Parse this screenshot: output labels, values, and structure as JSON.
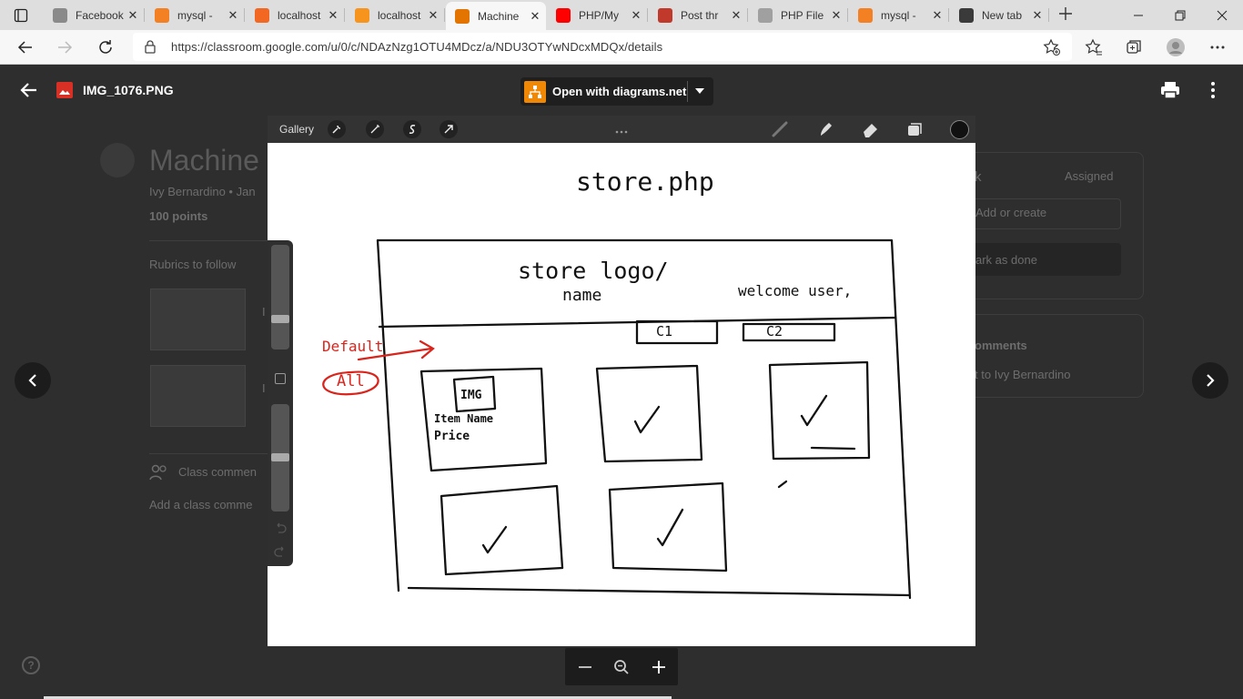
{
  "browser": {
    "tabs": [
      {
        "label": "Facebook",
        "color": "#8a8a8a"
      },
      {
        "label": "mysql - ",
        "color": "#f48024"
      },
      {
        "label": "localhost",
        "color": "#f26722"
      },
      {
        "label": "localhost",
        "color": "#f7941e"
      },
      {
        "label": "Machine",
        "color": "#e37400",
        "active": true
      },
      {
        "label": "PHP/My",
        "color": "#ff0000"
      },
      {
        "label": "Post thr",
        "color": "#c0392b"
      },
      {
        "label": "PHP File",
        "color": "#a0a0a0"
      },
      {
        "label": "mysql - ",
        "color": "#f48024"
      },
      {
        "label": "New tab",
        "color": "#3a3a3a"
      }
    ],
    "url": "https://classroom.google.com/u/0/c/NDAzNzg1OTU4MDcz/a/NDU3OTYwNDcxMDQx/details"
  },
  "viewer": {
    "file_name": "IMG_1076.PNG",
    "open_with_label": "Open with diagrams.net"
  },
  "classroom_bg": {
    "title": "Machine",
    "author": "Ivy Bernardino • Jan",
    "points": "100 points",
    "rubrics": "Rubrics to follow",
    "class_comments": "Class commen",
    "add_class_comment": "Add a class comme",
    "your_work": "k",
    "assigned": "Assigned",
    "add_or_create": "Add or create",
    "mark_as_done": "ark as done",
    "private_comments": "omments",
    "add_private": "t to Ivy Bernardino",
    "rubric_letter_1": "I",
    "rubric_letter_2": "I"
  },
  "procreate": {
    "gallery_label": "Gallery"
  },
  "sketch": {
    "title": "store.php",
    "logo_line1": "store logo/",
    "logo_line2": "name",
    "welcome": "welcome user,",
    "cat1": "C1",
    "cat2": "C2",
    "default_label": "Default",
    "all_label": "All",
    "img_label": "IMG",
    "item_name": "Item Name",
    "price": "Price"
  }
}
